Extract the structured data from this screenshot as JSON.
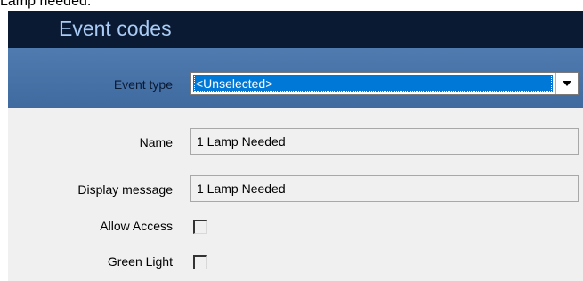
{
  "caption": "Lamp needed.",
  "window": {
    "title": "Event codes"
  },
  "filter": {
    "event_type_label": "Event type",
    "event_type_value": "<Unselected>"
  },
  "form": {
    "name_label": "Name",
    "name_value": "1 Lamp Needed",
    "display_message_label": "Display message",
    "display_message_value": "1 Lamp Needed",
    "allow_access_label": "Allow Access",
    "allow_access_checked": false,
    "green_light_label": "Green Light",
    "green_light_checked": false
  },
  "icons": {
    "dropdown": "chevron-down-icon"
  }
}
